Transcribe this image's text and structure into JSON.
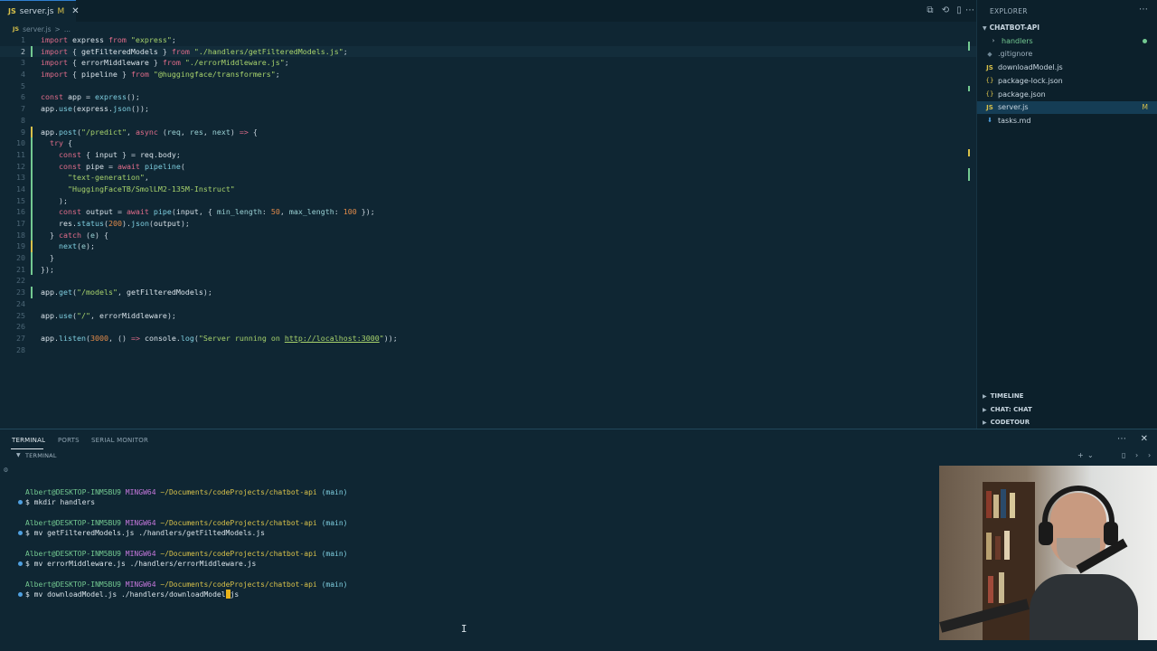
{
  "editor": {
    "tab": {
      "lang": "JS",
      "name": "server.js",
      "modified": "M"
    },
    "breadcrumb": [
      "server.js",
      ">",
      "..."
    ],
    "lines": [
      {
        "n": "1",
        "tokens": [
          [
            "k",
            "import "
          ],
          [
            "i",
            "express "
          ],
          [
            "k",
            "from "
          ],
          [
            "s",
            "\"express\""
          ],
          [
            "p",
            ";"
          ]
        ]
      },
      {
        "n": "2",
        "tokens": [
          [
            "k",
            "import "
          ],
          [
            "p",
            "{ "
          ],
          [
            "i",
            "getFilteredModels "
          ],
          [
            "p",
            "} "
          ],
          [
            "k",
            "from "
          ],
          [
            "s",
            "\"./handlers/getFilteredModels.js\""
          ],
          [
            "p",
            ";"
          ]
        ]
      },
      {
        "n": "3",
        "tokens": [
          [
            "k",
            "import "
          ],
          [
            "p",
            "{ "
          ],
          [
            "i",
            "errorMiddleware "
          ],
          [
            "p",
            "} "
          ],
          [
            "k",
            "from "
          ],
          [
            "s",
            "\"./errorMiddleware.js\""
          ],
          [
            "p",
            ";"
          ]
        ]
      },
      {
        "n": "4",
        "tokens": [
          [
            "k",
            "import "
          ],
          [
            "p",
            "{ "
          ],
          [
            "i",
            "pipeline "
          ],
          [
            "p",
            "} "
          ],
          [
            "k",
            "from "
          ],
          [
            "s",
            "\"@huggingface/transformers\""
          ],
          [
            "p",
            ";"
          ]
        ]
      },
      {
        "n": "5",
        "tokens": []
      },
      {
        "n": "6",
        "tokens": [
          [
            "k",
            "const "
          ],
          [
            "i",
            "app "
          ],
          [
            "p",
            "= "
          ],
          [
            "f",
            "express"
          ],
          [
            "p",
            "();"
          ]
        ]
      },
      {
        "n": "7",
        "tokens": [
          [
            "i",
            "app"
          ],
          [
            "p",
            "."
          ],
          [
            "f",
            "use"
          ],
          [
            "p",
            "("
          ],
          [
            "i",
            "express"
          ],
          [
            "p",
            "."
          ],
          [
            "f",
            "json"
          ],
          [
            "p",
            "());"
          ]
        ]
      },
      {
        "n": "8",
        "tokens": []
      },
      {
        "n": "9",
        "tokens": [
          [
            "i",
            "app"
          ],
          [
            "p",
            "."
          ],
          [
            "f",
            "post"
          ],
          [
            "p",
            "("
          ],
          [
            "s",
            "\"/predict\""
          ],
          [
            "p",
            ", "
          ],
          [
            "k",
            "async "
          ],
          [
            "p",
            "("
          ],
          [
            "v",
            "req"
          ],
          [
            "p",
            ", "
          ],
          [
            "v",
            "res"
          ],
          [
            "p",
            ", "
          ],
          [
            "v",
            "next"
          ],
          [
            "p",
            ") "
          ],
          [
            "k",
            "=> "
          ],
          [
            "p",
            "{"
          ]
        ]
      },
      {
        "n": "10",
        "tokens": [
          [
            "p",
            "  "
          ],
          [
            "k",
            "try "
          ],
          [
            "p",
            "{"
          ]
        ]
      },
      {
        "n": "11",
        "tokens": [
          [
            "p",
            "    "
          ],
          [
            "k",
            "const "
          ],
          [
            "p",
            "{ "
          ],
          [
            "i",
            "input "
          ],
          [
            "p",
            "} = "
          ],
          [
            "i",
            "req"
          ],
          [
            "p",
            "."
          ],
          [
            "i",
            "body"
          ],
          [
            "p",
            ";"
          ]
        ]
      },
      {
        "n": "12",
        "tokens": [
          [
            "p",
            "    "
          ],
          [
            "k",
            "const "
          ],
          [
            "i",
            "pipe "
          ],
          [
            "p",
            "= "
          ],
          [
            "k",
            "await "
          ],
          [
            "f",
            "pipeline"
          ],
          [
            "p",
            "("
          ]
        ]
      },
      {
        "n": "13",
        "tokens": [
          [
            "p",
            "      "
          ],
          [
            "s",
            "\"text-generation\""
          ],
          [
            "p",
            ","
          ]
        ]
      },
      {
        "n": "14",
        "tokens": [
          [
            "p",
            "      "
          ],
          [
            "s",
            "\"HuggingFaceTB/SmolLM2-135M-Instruct\""
          ]
        ]
      },
      {
        "n": "15",
        "tokens": [
          [
            "p",
            "    );"
          ]
        ]
      },
      {
        "n": "16",
        "tokens": [
          [
            "p",
            "    "
          ],
          [
            "k",
            "const "
          ],
          [
            "i",
            "output "
          ],
          [
            "p",
            "= "
          ],
          [
            "k",
            "await "
          ],
          [
            "f",
            "pipe"
          ],
          [
            "p",
            "("
          ],
          [
            "i",
            "input"
          ],
          [
            "p",
            ", { "
          ],
          [
            "v",
            "min_length"
          ],
          [
            "p",
            ": "
          ],
          [
            "n",
            "50"
          ],
          [
            "p",
            ", "
          ],
          [
            "v",
            "max_length"
          ],
          [
            "p",
            ": "
          ],
          [
            "n",
            "100"
          ],
          [
            "p",
            " });"
          ]
        ]
      },
      {
        "n": "17",
        "tokens": [
          [
            "p",
            "    "
          ],
          [
            "i",
            "res"
          ],
          [
            "p",
            "."
          ],
          [
            "f",
            "status"
          ],
          [
            "p",
            "("
          ],
          [
            "n",
            "200"
          ],
          [
            "p",
            ")."
          ],
          [
            "f",
            "json"
          ],
          [
            "p",
            "("
          ],
          [
            "i",
            "output"
          ],
          [
            "p",
            ");"
          ]
        ]
      },
      {
        "n": "18",
        "tokens": [
          [
            "p",
            "  } "
          ],
          [
            "k",
            "catch "
          ],
          [
            "p",
            "("
          ],
          [
            "v",
            "e"
          ],
          [
            "p",
            ") {"
          ]
        ]
      },
      {
        "n": "19",
        "tokens": [
          [
            "p",
            "    "
          ],
          [
            "f",
            "next"
          ],
          [
            "p",
            "("
          ],
          [
            "v",
            "e"
          ],
          [
            "p",
            ");"
          ]
        ]
      },
      {
        "n": "20",
        "tokens": [
          [
            "p",
            "  }"
          ]
        ]
      },
      {
        "n": "21",
        "tokens": [
          [
            "p",
            "});"
          ]
        ]
      },
      {
        "n": "22",
        "tokens": []
      },
      {
        "n": "23",
        "tokens": [
          [
            "i",
            "app"
          ],
          [
            "p",
            "."
          ],
          [
            "f",
            "get"
          ],
          [
            "p",
            "("
          ],
          [
            "s",
            "\"/models\""
          ],
          [
            "p",
            ", "
          ],
          [
            "i",
            "getFilteredModels"
          ],
          [
            "p",
            ");"
          ]
        ]
      },
      {
        "n": "24",
        "tokens": []
      },
      {
        "n": "25",
        "tokens": [
          [
            "i",
            "app"
          ],
          [
            "p",
            "."
          ],
          [
            "f",
            "use"
          ],
          [
            "p",
            "("
          ],
          [
            "s",
            "\"/\""
          ],
          [
            "p",
            ", "
          ],
          [
            "i",
            "errorMiddleware"
          ],
          [
            "p",
            ");"
          ]
        ]
      },
      {
        "n": "26",
        "tokens": []
      },
      {
        "n": "27",
        "tokens": [
          [
            "i",
            "app"
          ],
          [
            "p",
            "."
          ],
          [
            "f",
            "listen"
          ],
          [
            "p",
            "("
          ],
          [
            "n",
            "3000"
          ],
          [
            "p",
            ", () "
          ],
          [
            "k",
            "=> "
          ],
          [
            "i",
            "console"
          ],
          [
            "p",
            "."
          ],
          [
            "f",
            "log"
          ],
          [
            "p",
            "("
          ],
          [
            "s",
            "\"Server running on "
          ],
          [
            "u",
            "http://localhost:3000"
          ],
          [
            "s",
            "\""
          ],
          [
            "p",
            "));"
          ]
        ]
      },
      {
        "n": "28",
        "tokens": []
      }
    ]
  },
  "explorer": {
    "title": "EXPLORER",
    "project": "CHATBOT-API",
    "items": [
      {
        "label": "handlers",
        "icon": "chevron-right-icon",
        "kind": "folder"
      },
      {
        "label": ".gitignore",
        "icon": "git-icon",
        "kind": "file"
      },
      {
        "label": "downloadModel.js",
        "icon": "js-icon",
        "kind": "file"
      },
      {
        "label": "package-lock.json",
        "icon": "json-icon",
        "kind": "file"
      },
      {
        "label": "package.json",
        "icon": "json-icon",
        "kind": "file"
      },
      {
        "label": "server.js",
        "icon": "js-icon",
        "kind": "file",
        "badge": "M"
      },
      {
        "label": "tasks.md",
        "icon": "md-icon",
        "kind": "file"
      }
    ],
    "sections": [
      "TIMELINE",
      "CHAT: CHAT",
      "CODETOUR"
    ]
  },
  "panel": {
    "tabs": [
      "TERMINAL",
      "PORTS",
      "SERIAL MONITOR"
    ],
    "terminal_label": "TERMINAL",
    "prompt": {
      "user": "Albert@DESKTOP-INM5BU9",
      "host": "MINGW64",
      "path": "~/Documents/codeProjects/chatbot-api",
      "branch": "(main)"
    },
    "commands": [
      "$ mkdir handlers",
      "$ mv getFilteredModels.js ./handlers/getFiltedModels.js",
      "$ mv errorMiddleware.js ./handlers/errorMiddleware.js",
      "$ mv downloadModel.js ./handlers/downloadModel",
      "js"
    ]
  },
  "colors": {
    "accent": "#2f7fd0",
    "modified": "#d8c14a",
    "added": "#73c991"
  }
}
